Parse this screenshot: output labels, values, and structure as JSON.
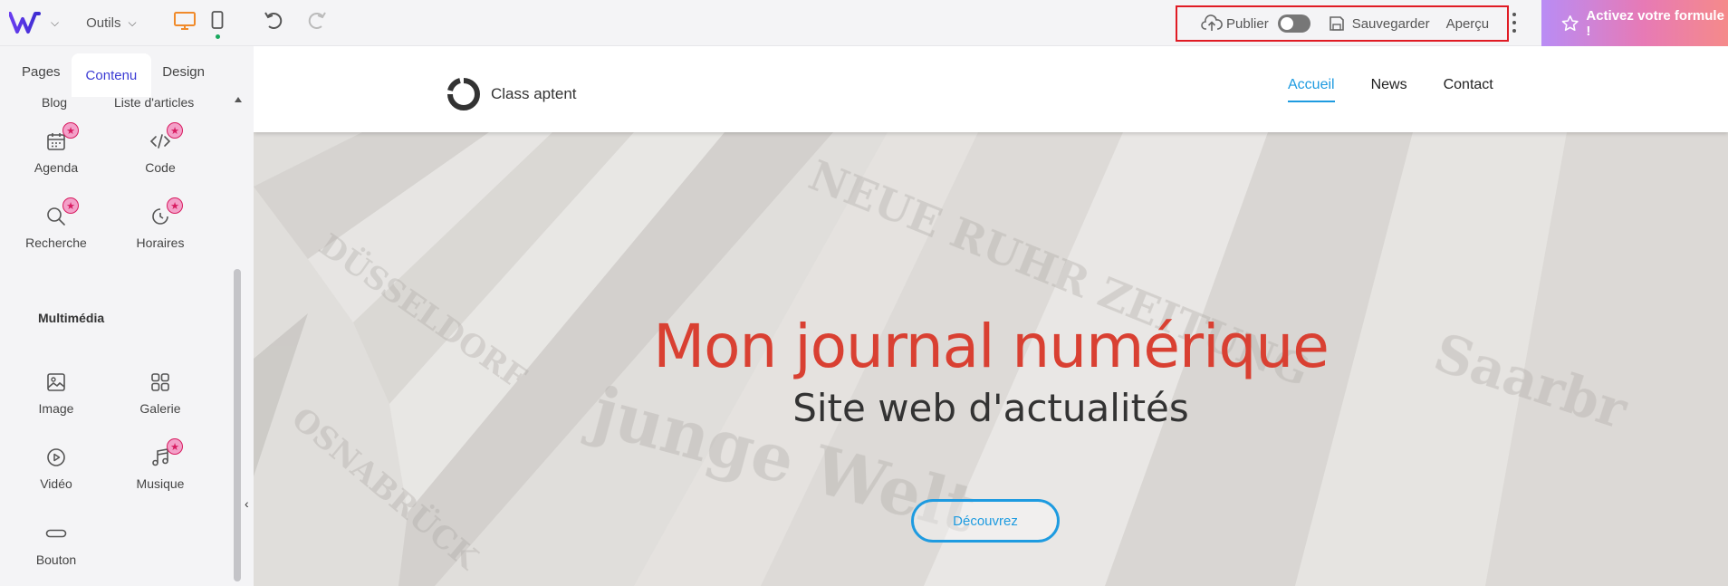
{
  "topbar": {
    "logo_icon": "w-logo-icon",
    "tools_label": "Outils",
    "publish_label": "Publier",
    "save_label": "Sauvegarder",
    "preview_label": "Aperçu",
    "cta_label": "Activez votre formule !"
  },
  "sidebar": {
    "tabs": [
      "Pages",
      "Contenu",
      "Design"
    ],
    "active_tab": "Contenu",
    "cut_items": [
      "Blog",
      "Liste d'articles"
    ],
    "items": [
      {
        "label": "Agenda",
        "icon": "calendar-icon",
        "premium": true
      },
      {
        "label": "Code",
        "icon": "code-icon",
        "premium": true
      },
      {
        "label": "Recherche",
        "icon": "search-icon",
        "premium": true
      },
      {
        "label": "Horaires",
        "icon": "clock-icon",
        "premium": true
      }
    ],
    "section_title": "Multimédia",
    "media_items": [
      {
        "label": "Image",
        "icon": "image-icon",
        "premium": false
      },
      {
        "label": "Galerie",
        "icon": "gallery-icon",
        "premium": false
      },
      {
        "label": "Vidéo",
        "icon": "video-icon",
        "premium": false
      },
      {
        "label": "Musique",
        "icon": "music-icon",
        "premium": true
      },
      {
        "label": "Bouton",
        "icon": "button-icon",
        "premium": false
      }
    ]
  },
  "site": {
    "brand_name": "Class aptent",
    "nav": [
      "Accueil",
      "News",
      "Contact"
    ],
    "active_nav": "Accueil",
    "hero_title": "Mon journal numérique",
    "hero_subtitle": "Site web d'actualités",
    "hero_button": "Découvrez"
  },
  "colors": {
    "accent": "#3b3bd4",
    "hero_title": "#d94032",
    "link": "#1e9be0",
    "highlight_box": "#e01b24",
    "desktop_icon": "#f08a2a"
  }
}
